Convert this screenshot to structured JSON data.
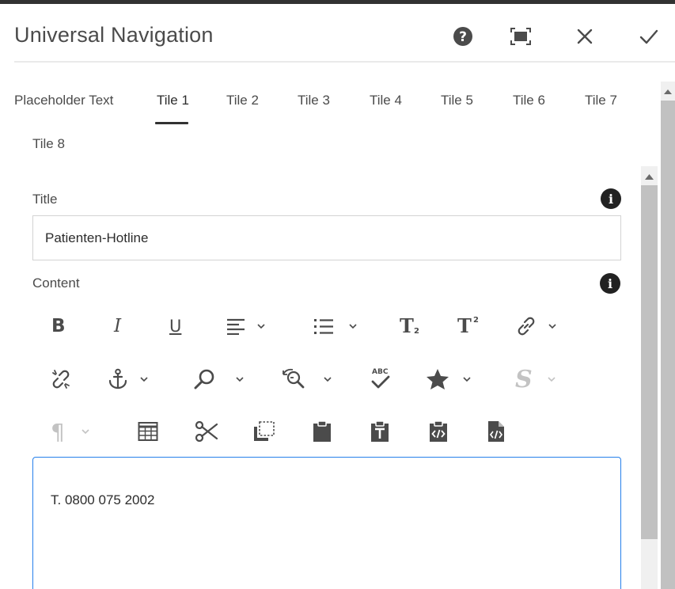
{
  "dialog": {
    "title": "Universal Navigation",
    "icons": {
      "help": "help-icon",
      "fullscreen": "fullscreen-icon",
      "close": "close-icon",
      "done": "checkmark-icon"
    }
  },
  "tabs": [
    {
      "label": "Placeholder Text",
      "active": false
    },
    {
      "label": "Tile 1",
      "active": true
    },
    {
      "label": "Tile 2",
      "active": false
    },
    {
      "label": "Tile 3",
      "active": false
    },
    {
      "label": "Tile 4",
      "active": false
    },
    {
      "label": "Tile 5",
      "active": false
    },
    {
      "label": "Tile 6",
      "active": false
    },
    {
      "label": "Tile 7",
      "active": false
    },
    {
      "label": "Tile 8",
      "active": false
    }
  ],
  "form": {
    "title_label": "Title",
    "title_value": "Patienten-Hotline",
    "content_label": "Content",
    "info_glyph": "i",
    "editor_text": "T. 0800 075 2002"
  },
  "toolbar": {
    "bold": "B",
    "italic": "I",
    "underline": "U",
    "subscript_main": "T",
    "subscript_index": "2",
    "superscript_main": "T",
    "superscript_index": "2",
    "strikethrough": "S",
    "paragraph": "¶",
    "spellcheck_label": "ABC",
    "icons": [
      "bold-icon",
      "italic-icon",
      "underline-icon",
      "align-icon",
      "list-icon",
      "subscript-icon",
      "superscript-icon",
      "link-icon",
      "unlink-icon",
      "anchor-icon",
      "find-icon",
      "find-replace-icon",
      "spellcheck-icon",
      "special-chars-icon",
      "styles-icon",
      "paragraph-format-icon",
      "table-icon",
      "cut-icon",
      "copy-icon",
      "paste-icon",
      "paste-text-icon",
      "paste-html-icon",
      "source-edit-icon"
    ]
  }
}
